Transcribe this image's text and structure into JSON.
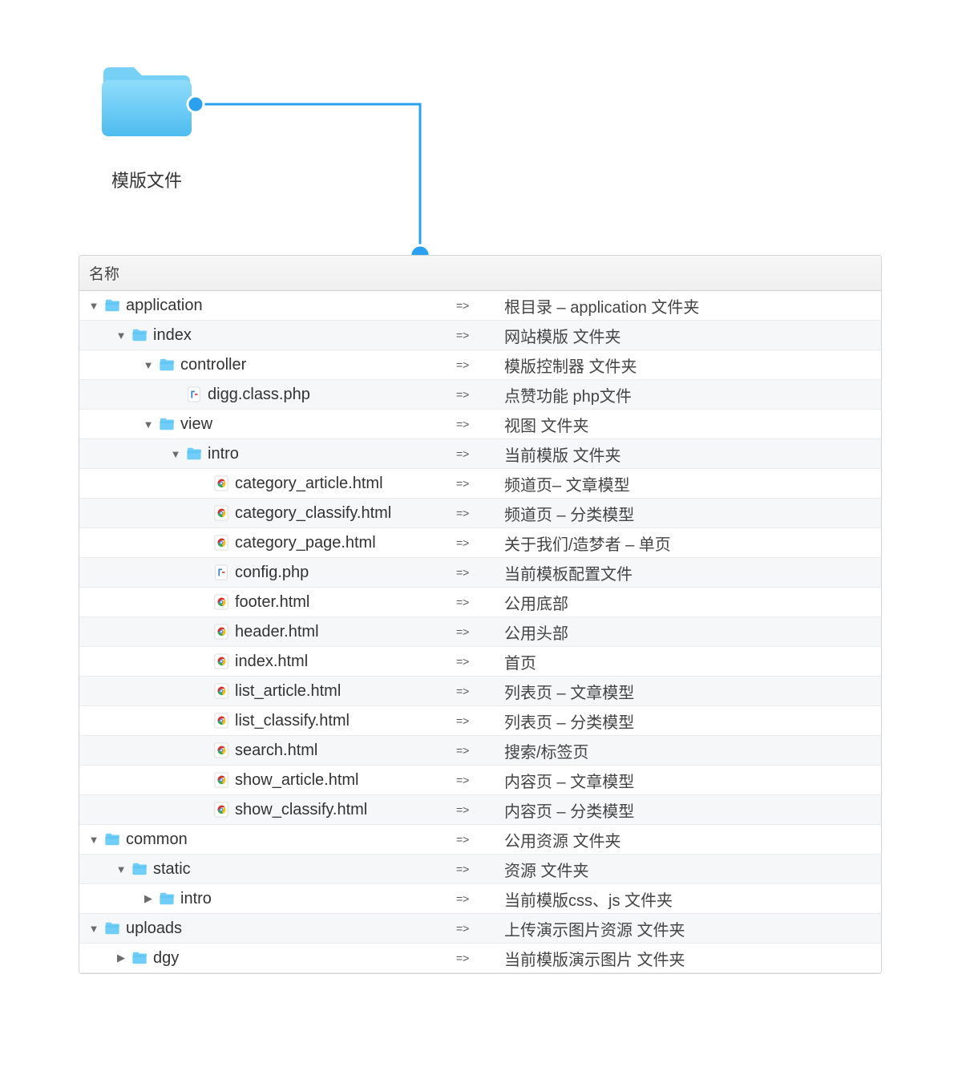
{
  "top_folder_label": "模版文件",
  "header": "名称",
  "arrow": "=>",
  "indent_unit": 34,
  "colors": {
    "folder_fill": "#6fcdf7",
    "folder_fill_dark": "#46b9ef",
    "connector": "#2aa0ef",
    "chrome_outer": "#d93025",
    "chrome_g": "#34a853",
    "chrome_y": "#fbbc05",
    "chrome_b": "#4285f4",
    "php1": "#3f86c7",
    "php2": "#e15151"
  },
  "items": [
    {
      "lvl": 0,
      "tri": "down",
      "icon": "folder",
      "name": "application",
      "desc": "根目录 – application 文件夹"
    },
    {
      "lvl": 1,
      "tri": "down",
      "icon": "folder",
      "name": "index",
      "desc": "网站模版 文件夹"
    },
    {
      "lvl": 2,
      "tri": "down",
      "icon": "folder",
      "name": "controller",
      "desc": "模版控制器 文件夹"
    },
    {
      "lvl": 3,
      "tri": "",
      "icon": "php",
      "name": "digg.class.php",
      "desc": "点赞功能 php文件"
    },
    {
      "lvl": 2,
      "tri": "down",
      "icon": "folder",
      "name": "view",
      "desc": "视图 文件夹"
    },
    {
      "lvl": 3,
      "tri": "down",
      "icon": "folder",
      "name": "intro",
      "desc": "当前模版 文件夹"
    },
    {
      "lvl": 4,
      "tri": "",
      "icon": "chrome",
      "name": "category_article.html",
      "desc": "频道页– 文章模型"
    },
    {
      "lvl": 4,
      "tri": "",
      "icon": "chrome",
      "name": "category_classify.html",
      "desc": "频道页 – 分类模型"
    },
    {
      "lvl": 4,
      "tri": "",
      "icon": "chrome",
      "name": "category_page.html",
      "desc": "关于我们/造梦者 – 单页"
    },
    {
      "lvl": 4,
      "tri": "",
      "icon": "php",
      "name": "config.php",
      "desc": "当前模板配置文件"
    },
    {
      "lvl": 4,
      "tri": "",
      "icon": "chrome",
      "name": "footer.html",
      "desc": "公用底部"
    },
    {
      "lvl": 4,
      "tri": "",
      "icon": "chrome",
      "name": "header.html",
      "desc": "公用头部"
    },
    {
      "lvl": 4,
      "tri": "",
      "icon": "chrome",
      "name": "index.html",
      "desc": "首页"
    },
    {
      "lvl": 4,
      "tri": "",
      "icon": "chrome",
      "name": "list_article.html",
      "desc": "列表页 – 文章模型"
    },
    {
      "lvl": 4,
      "tri": "",
      "icon": "chrome",
      "name": "list_classify.html",
      "desc": "列表页 – 分类模型"
    },
    {
      "lvl": 4,
      "tri": "",
      "icon": "chrome",
      "name": "search.html",
      "desc": "搜索/标签页"
    },
    {
      "lvl": 4,
      "tri": "",
      "icon": "chrome",
      "name": "show_article.html",
      "desc": "内容页 – 文章模型"
    },
    {
      "lvl": 4,
      "tri": "",
      "icon": "chrome",
      "name": "show_classify.html",
      "desc": "内容页 – 分类模型"
    },
    {
      "lvl": 0,
      "tri": "down",
      "icon": "folder",
      "name": "common",
      "desc": "公用资源 文件夹"
    },
    {
      "lvl": 1,
      "tri": "down",
      "icon": "folder",
      "name": "static",
      "desc": "资源 文件夹"
    },
    {
      "lvl": 2,
      "tri": "right",
      "icon": "folder",
      "name": "intro",
      "desc": "当前模版css、js 文件夹"
    },
    {
      "lvl": 0,
      "tri": "down",
      "icon": "folder",
      "name": "uploads",
      "desc": "上传演示图片资源 文件夹"
    },
    {
      "lvl": 1,
      "tri": "right",
      "icon": "folder",
      "name": "dgy",
      "desc": "当前模版演示图片 文件夹"
    }
  ]
}
